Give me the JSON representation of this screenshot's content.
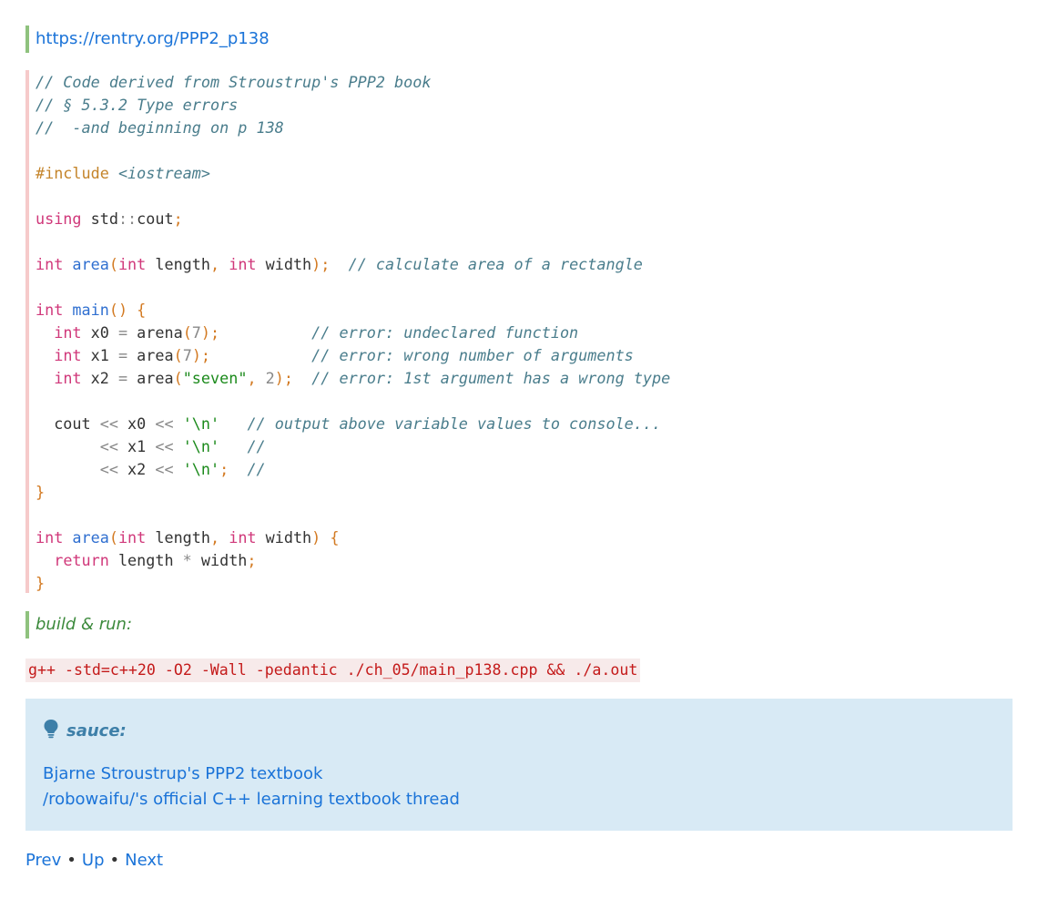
{
  "header_link": "https://rentry.org/PPP2_p138",
  "code_lines": [
    "// Code derived from Stroustrup's PPP2 book",
    "// § 5.3.2 Type errors",
    "//  -and beginning on p 138",
    "#include <iostream>",
    "using std::cout;",
    "int area(int length, int width);  // calculate area of a rectangle",
    "int main() {",
    "  int x0 = arena(7);          // error: undeclared function",
    "  int x1 = area(7);           // error: wrong number of arguments",
    "  int x2 = area(\"seven\", 2);  // error: 1st argument has a wrong type",
    "  cout << x0 << '\\n'   // output above variable values to console...",
    "       << x1 << '\\n'   //",
    "       << x2 << '\\n';  //",
    "}",
    "int area(int length, int width) {",
    "  return length * width;",
    "}"
  ],
  "build_label": "build & run:",
  "build_command": "g++ -std=c++20 -O2 -Wall -pedantic ./ch_05/main_p138.cpp && ./a.out",
  "note": {
    "icon": "lightbulb-icon",
    "title": "sauce:",
    "links": [
      "Bjarne Stroustrup's PPP2 textbook",
      "/robowaifu/'s official C++ learning textbook thread"
    ]
  },
  "nav": {
    "prev": "Prev",
    "up": "Up",
    "next": "Next",
    "separator": "•"
  },
  "colors": {
    "link": "#1a73d8",
    "note_bg": "#d8eaf5",
    "quote_border": "#8fc27e",
    "code_border": "#f6caca"
  }
}
